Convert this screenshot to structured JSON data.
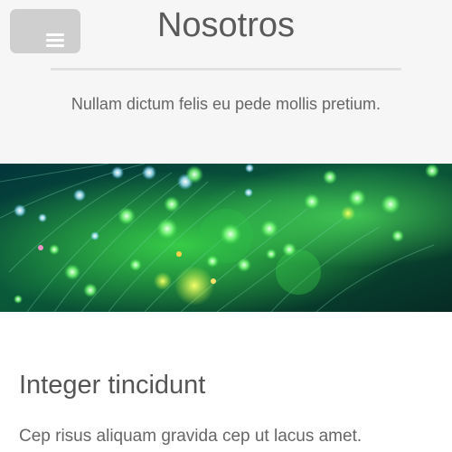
{
  "header": {
    "title": "Nosotros",
    "menu_icon": "hamburger-menu-icon",
    "subtitle": "Nullam dictum felis eu pede mollis pretium."
  },
  "banner": {
    "image": "green fiber optic lights"
  },
  "section": {
    "heading": "Integer tincidunt",
    "text": "Cep risus aliquam gravida cep ut lacus amet."
  }
}
